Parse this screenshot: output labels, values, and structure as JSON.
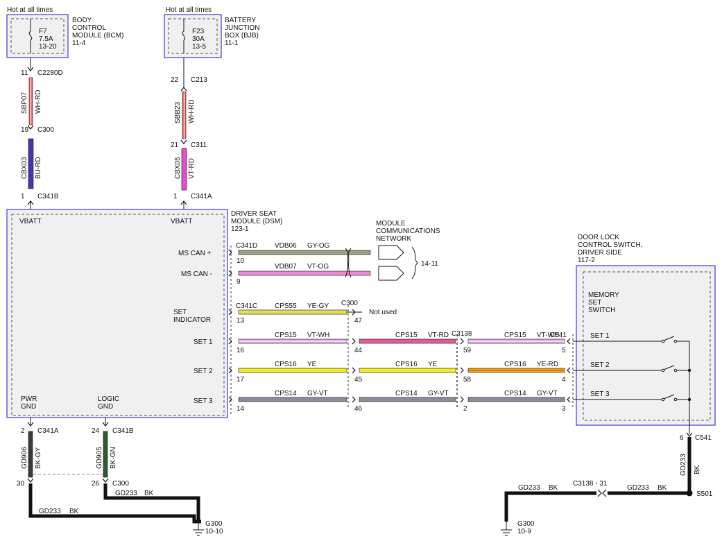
{
  "sources": {
    "hot_left": "Hot at all times",
    "hot_right": "Hot at all times",
    "bcm": {
      "fuse": [
        "F7",
        "7.5A",
        "13-20"
      ],
      "title": [
        "BODY",
        "CONTROL",
        "MODULE (BCM)",
        "11-4"
      ]
    },
    "bjb": {
      "fuse": [
        "F23",
        "30A",
        "13-5"
      ],
      "title": [
        "BATTERY",
        "JUNCTION",
        "BOX (BJB)",
        "11-1"
      ]
    }
  },
  "left_feed": {
    "pin_top": "11",
    "conn_top": "C2280D",
    "circuit_top": "SBP07",
    "color_top": "WH-RD",
    "pin_mid": "19",
    "conn_mid": "C300",
    "circuit_bot": "CBX03",
    "color_bot": "BU-RD",
    "pin_bot": "1",
    "conn_bot": "C341B"
  },
  "right_feed": {
    "pin_top": "22",
    "conn_top": "C213",
    "circuit_top": "SBB23",
    "color_top": "WH-RD",
    "pin_mid": "21",
    "conn_mid": "C311",
    "circuit_bot": "CBX05",
    "color_bot": "VT-RD",
    "pin_bot": "1",
    "conn_bot": "C341A"
  },
  "dsm": {
    "title": [
      "DRIVER SEAT",
      "MODULE (DSM)",
      "123-1"
    ],
    "vbatt_left": "VBATT",
    "vbatt_right": "VBATT",
    "ms_can_hi": "MS CAN +",
    "ms_can_lo": "MS CAN -",
    "set_indicator": [
      "SET",
      "INDICATOR"
    ],
    "set1": "SET 1",
    "set2": "SET 2",
    "set3": "SET 3",
    "pwr_gnd": [
      "PWR",
      "GND"
    ],
    "logic_gnd": [
      "LOGIC",
      "GND"
    ]
  },
  "network": {
    "title": [
      "MODULE",
      "COMMUNICATIONS",
      "NETWORK"
    ],
    "ref": "14-11",
    "conn": "C341D",
    "can_hi": {
      "pin": "10",
      "circuit": "VDB06",
      "color": "GY-OG"
    },
    "can_lo": {
      "pin": "9",
      "circuit": "VDB07",
      "color": "VT-OG"
    }
  },
  "set_indicator_wire": {
    "conn": "C341C",
    "pin": "13",
    "circuit": "CPS55",
    "color": "YE-GY",
    "c300": "C300",
    "c300_pin": "47",
    "note": "Not used"
  },
  "set_rows": [
    {
      "dsm_pin": "16",
      "c300_pin": "44",
      "c3138_pin": "59",
      "c541_pin": "5",
      "seg1": {
        "circuit": "CPS15",
        "color": "VT-WH"
      },
      "seg2": {
        "circuit": "CPS15",
        "color": "VT-RD"
      },
      "seg3": {
        "circuit": "CPS15",
        "color": "VT-WH"
      },
      "switch_label": "SET 1"
    },
    {
      "dsm_pin": "17",
      "c300_pin": "45",
      "c3138_pin": "58",
      "c541_pin": "4",
      "seg1": {
        "circuit": "CPS16",
        "color": "YE"
      },
      "seg2": {
        "circuit": "CPS16",
        "color": "YE"
      },
      "seg3": {
        "circuit": "CPS16",
        "color": "YE-RD"
      },
      "switch_label": "SET 2"
    },
    {
      "dsm_pin": "14",
      "c300_pin": "46",
      "c3138_pin": "2",
      "c541_pin": "3",
      "seg1": {
        "circuit": "CPS14",
        "color": "GY-VT"
      },
      "seg2": {
        "circuit": "CPS14",
        "color": "GY-VT"
      },
      "seg3": {
        "circuit": "CPS14",
        "color": "GY-VT"
      },
      "switch_label": "SET 3"
    }
  ],
  "c3138_label": "C3138",
  "c541_label": "C541",
  "door_switch": {
    "title": [
      "DOOR LOCK",
      "CONTROL SWITCH,",
      "DRIVER SIDE",
      "117-2"
    ],
    "memory": [
      "MEMORY",
      "SET",
      "SWITCH"
    ]
  },
  "grounds_left": {
    "pwr": {
      "pin": "2",
      "conn": "C341A",
      "circuit": "GD906",
      "color": "BK-GY",
      "c300_pin": "30"
    },
    "logic": {
      "pin": "24",
      "conn": "C341B",
      "circuit": "GD905",
      "color": "BK-GN",
      "c300_pin": "26",
      "c300": "C300"
    },
    "run1": {
      "circuit": "GD233",
      "color": "BK"
    },
    "run2": {
      "circuit": "GD233",
      "color": "BK"
    },
    "ground": "G300",
    "ground_ref": "10-10"
  },
  "grounds_right": {
    "c541_pin": "6",
    "c541": "C541",
    "vert": {
      "circuit": "GD233",
      "color": "BK"
    },
    "splice": "S501",
    "run_right": {
      "circuit": "GD233",
      "color": "BK"
    },
    "c3138_ref": "C3138 - 31",
    "run_left": {
      "circuit": "GD233",
      "color": "BK"
    },
    "ground": "G300",
    "ground_ref": "10-9"
  },
  "colors": {
    "box_blue": "#3b3bd6",
    "box_fill": "#f0f0f0",
    "dash": "#555555",
    "wh_rd": "#e86a6a",
    "bu_rd": "#4a2fb8",
    "vt_rd": "#e24fc8",
    "gy_og": "#a09e80",
    "vt_og": "#ef8ad6",
    "ye_gy": "#e5e05a",
    "vt_wh": "#e6a8ea",
    "vt_rd_wire": "#e85a9e",
    "ye": "#f2ef2a",
    "ye_rd": "#f4b020",
    "gy_vt": "#8a8a9a",
    "bk": "#111111",
    "bk_gy": "#3a3a3a",
    "bk_gn": "#2e5a2e"
  }
}
